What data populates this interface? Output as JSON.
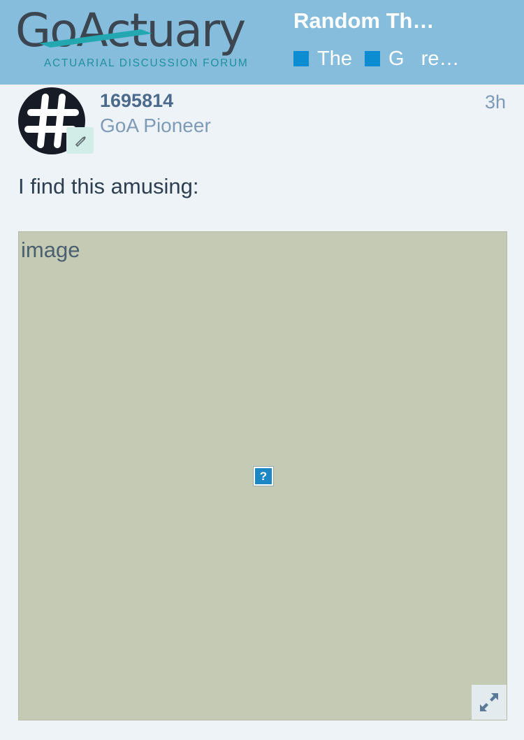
{
  "header": {
    "logo": {
      "wordmark": "GoActuary",
      "tagline": "ACTUARIAL DISCUSSION FORUM"
    },
    "topic_title": "Random Th…",
    "breadcrumbs": [
      {
        "label": "The",
        "color": "#0d8dd1"
      },
      {
        "label": "G   re…",
        "color": "#0d8dd1"
      }
    ]
  },
  "post": {
    "author": {
      "username": "1695814",
      "title": "GoA Pioneer",
      "avatar_icon": "hashtag-icon",
      "flair_icon": "pencil-flair-icon"
    },
    "date": "3h",
    "text": "I find this amusing:",
    "image": {
      "alt": "image",
      "broken_glyph": "?",
      "expand_icon": "expand-icon"
    }
  },
  "colors": {
    "header_bg": "#87bddc",
    "page_bg": "#eef3f8",
    "category": "#0d8dd1",
    "image_placeholder": "#c5cab4"
  }
}
